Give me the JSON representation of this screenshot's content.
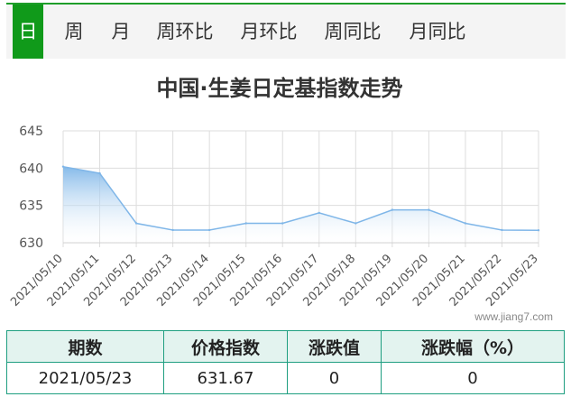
{
  "tabs": [
    {
      "label": "日",
      "active": true
    },
    {
      "label": "周",
      "active": false
    },
    {
      "label": "月",
      "active": false
    },
    {
      "label": "周环比",
      "active": false
    },
    {
      "label": "月环比",
      "active": false
    },
    {
      "label": "周同比",
      "active": false
    },
    {
      "label": "月同比",
      "active": false
    }
  ],
  "watermark": "www.jiang7.com",
  "colors": {
    "accent": "#109a1a",
    "series": "#7fb6e8",
    "table_border": "#1e9e80"
  },
  "chart_data": {
    "type": "area",
    "title": "中国·生姜日定基指数走势",
    "xlabel": "",
    "ylabel": "",
    "ylim": [
      630,
      645
    ],
    "yticks": [
      630,
      635,
      640,
      645
    ],
    "grid": true,
    "categories": [
      "2021/05/10",
      "2021/05/11",
      "2021/05/12",
      "2021/05/13",
      "2021/05/14",
      "2021/05/15",
      "2021/05/16",
      "2021/05/17",
      "2021/05/18",
      "2021/05/19",
      "2021/05/20",
      "2021/05/21",
      "2021/05/22",
      "2021/05/23"
    ],
    "series": [
      {
        "values": [
          640.2,
          639.3,
          632.6,
          631.7,
          631.7,
          632.6,
          632.6,
          634.0,
          632.6,
          634.4,
          634.4,
          632.6,
          631.7,
          631.67
        ]
      }
    ]
  },
  "table": {
    "headers": [
      "期数",
      "价格指数",
      "涨跌值",
      "涨跌幅（%）"
    ],
    "rows": [
      [
        "2021/05/23",
        "631.67",
        "0",
        "0"
      ]
    ]
  }
}
